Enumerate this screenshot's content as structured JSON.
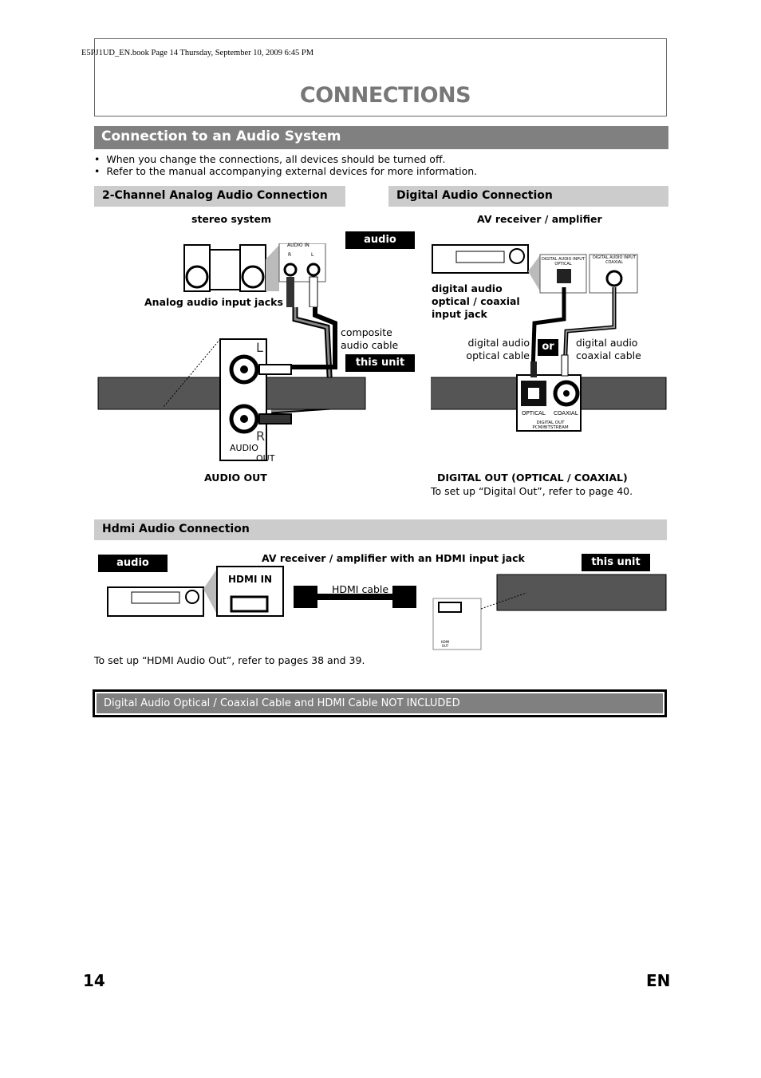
{
  "header": {
    "book_line": "E5PJ1UD_EN.book  Page 14  Thursday, September 10, 2009  6:45 PM",
    "title": "CONNECTIONS"
  },
  "section": {
    "title": "Connection to an Audio System",
    "bullets": [
      "When you change the connections, all devices should be turned off.",
      "Refer to the manual accompanying external devices for more information."
    ]
  },
  "analog": {
    "title": "2-Channel Analog Audio Connection",
    "device": "stereo system",
    "jacks_label": "Analog audio input jacks",
    "audio_in": "AUDIO IN",
    "r": "R",
    "l": "L",
    "cable": "composite\naudio cable",
    "audio_badge": "audio",
    "unit_badge": "this unit",
    "big_l": "L",
    "big_r": "R",
    "audio": "AUDIO",
    "out": "OUT",
    "footer": "AUDIO OUT"
  },
  "digital": {
    "title": "Digital Audio Connection",
    "device": "AV receiver / amplifier",
    "jack_label": "digital audio\noptical / coaxial\ninput jack",
    "opt_in": "DIGITAL AUDIO INPUT\nOPTICAL",
    "coax_in": "DIGITAL AUDIO INPUT\nCOAXIAL",
    "opt_cable": "digital audio\noptical cable",
    "coax_cable": "digital audio\ncoaxial cable",
    "or": "or",
    "optical": "OPTICAL",
    "coaxial": "COAXIAL",
    "digital_out": "DIGITAL OUT\nPCM/BITSTREAM",
    "footer": "DIGITAL OUT (OPTICAL / COAXIAL)",
    "footer_note": "To set up “Digital Out”, refer to page 40."
  },
  "hdmi": {
    "title": "Hdmi Audio Connection",
    "audio_badge": "audio",
    "device": "AV receiver / amplifier with an HDMI input jack",
    "unit_badge": "this unit",
    "hdmi_in": "HDMI IN",
    "cable": "HDMI cable",
    "hdmi_out": "HDMI\nOUT",
    "note": "To set up  “HDMI Audio Out”, refer to pages 38 and 39."
  },
  "notice": "Digital Audio Optical / Coaxial Cable and HDMI Cable NOT INCLUDED",
  "footer": {
    "page": "14",
    "lang": "EN"
  }
}
